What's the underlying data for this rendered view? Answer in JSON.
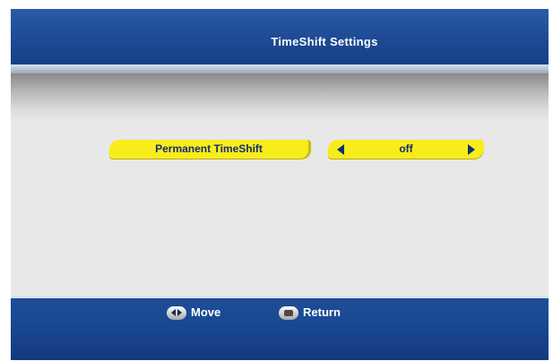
{
  "header": {
    "title": "TimeShift Settings"
  },
  "settings": [
    {
      "label": "Permanent TimeShift",
      "value": "off"
    }
  ],
  "footer": {
    "hints": [
      {
        "label": "Move",
        "icon": "left-right-button-icon"
      },
      {
        "label": "Return",
        "icon": "exit-button-icon"
      }
    ]
  },
  "colors": {
    "header_blue": "#1e4a94",
    "highlight_yellow": "#f8ec1a",
    "text_navy": "#142d73",
    "panel_gray": "#e8e8e8"
  }
}
